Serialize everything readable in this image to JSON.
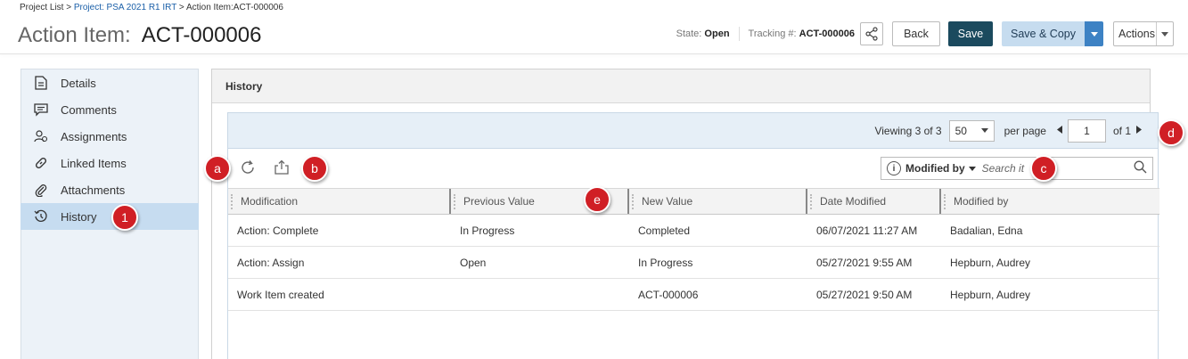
{
  "breadcrumb": {
    "project_list": "Project List",
    "sep1": " > ",
    "project": "Project: PSA 2021 R1 IRT",
    "sep2": " > ",
    "current": "Action Item:ACT-000006"
  },
  "header": {
    "title_label": "Action Item:",
    "title_value": "ACT-000006",
    "state_label": "State:",
    "state_value": "Open",
    "tracking_label": "Tracking #:",
    "tracking_value": "ACT-000006",
    "back_label": "Back",
    "save_label": "Save",
    "save_copy_label": "Save & Copy",
    "actions_label": "Actions"
  },
  "sidebar": {
    "items": [
      {
        "label": "Details",
        "icon": "document-icon"
      },
      {
        "label": "Comments",
        "icon": "comment-icon"
      },
      {
        "label": "Assignments",
        "icon": "people-icon"
      },
      {
        "label": "Linked Items",
        "icon": "link-icon"
      },
      {
        "label": "Attachments",
        "icon": "paperclip-icon"
      },
      {
        "label": "History",
        "icon": "history-icon",
        "active": true
      }
    ]
  },
  "main": {
    "title": "History"
  },
  "pager": {
    "viewing_prefix": "Viewing ",
    "viewing_range": "3 of 3",
    "per_page_value": "50",
    "per_page_label": "per page",
    "page_value": "1",
    "of_label": "of 1"
  },
  "filter": {
    "field": "Modified by",
    "placeholder": "Search it"
  },
  "table": {
    "columns": [
      "Modification",
      "Previous Value",
      "New Value",
      "Date Modified",
      "Modified by"
    ],
    "rows": [
      [
        "Action: Complete",
        "In Progress",
        "Completed",
        "06/07/2021 11:27 AM",
        "Badalian, Edna"
      ],
      [
        "Action: Assign",
        "Open",
        "In Progress",
        "05/27/2021 9:55 AM",
        "Hepburn, Audrey"
      ],
      [
        "Work Item created",
        "",
        "ACT-000006",
        "05/27/2021 9:50 AM",
        "Hepburn, Audrey"
      ]
    ]
  },
  "callouts": [
    "1",
    "a",
    "b",
    "c",
    "d",
    "e"
  ],
  "colors": {
    "save": "#1b4a5e",
    "save_copy": "#c6dcef",
    "callout": "#d01f25",
    "sidebar_active": "#c6dcf0"
  }
}
